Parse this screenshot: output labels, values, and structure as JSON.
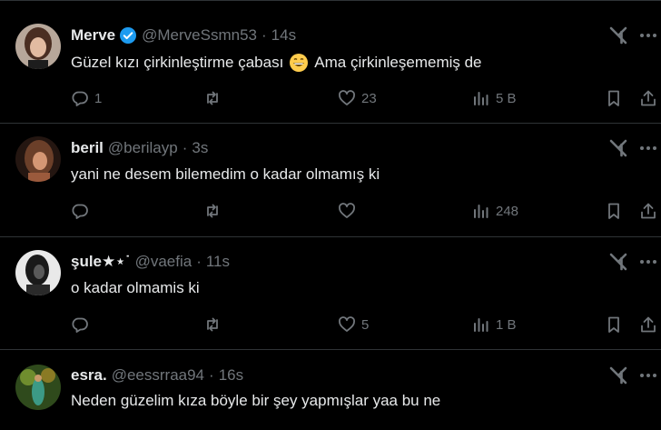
{
  "posts": [
    {
      "name": "Merve",
      "verified": true,
      "handle": "@MerveSsmn53",
      "separator": "·",
      "time": "14s",
      "text_before": "Güzel kızı çirkinleştirme çabası",
      "emoji": "grinning-face-emoji",
      "text_after": "Ama çirkinleşememiş de",
      "replies": "1",
      "retweets": "",
      "likes": "23",
      "views": "5 B"
    },
    {
      "name": "beril",
      "verified": false,
      "handle": "@berilayp",
      "separator": "·",
      "time": "3s",
      "text_before": "yani ne desem bilemedim o kadar olmamış ki",
      "replies": "",
      "retweets": "",
      "likes": "",
      "views": "248"
    },
    {
      "name": "şule★⋆˙",
      "verified": false,
      "handle": "@vaefia",
      "separator": "·",
      "time": "11s",
      "text_before": "o kadar olmamis ki",
      "replies": "",
      "retweets": "",
      "likes": "5",
      "views": "1 B"
    },
    {
      "name": "esra.",
      "verified": false,
      "handle": "@eessrraa94",
      "separator": "·",
      "time": "16s",
      "text_before": "Neden güzelim kıza böyle bir şey yapmışlar yaa bu ne"
    }
  ],
  "colors": {
    "background": "#000000",
    "text": "#e7e9ea",
    "muted": "#71767b",
    "divider": "#2f3336",
    "verified": "#1d9bf0"
  }
}
